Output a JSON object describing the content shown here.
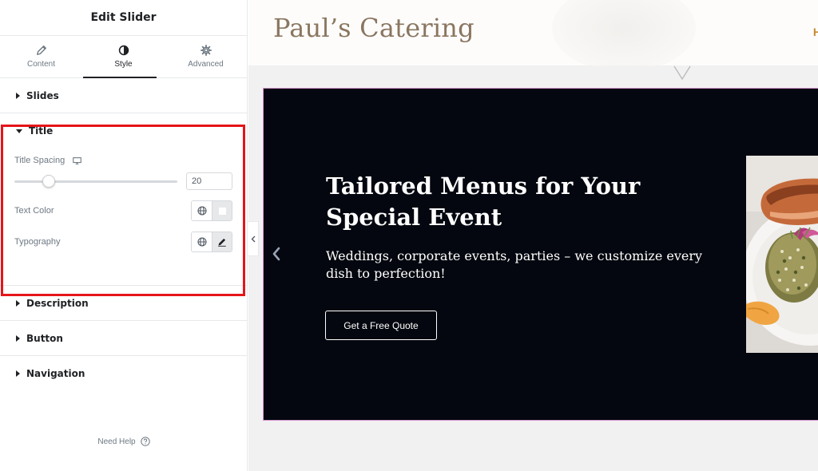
{
  "panel": {
    "title": "Edit Slider",
    "tabs": [
      {
        "label": "Content",
        "icon": "pencil-icon"
      },
      {
        "label": "Style",
        "icon": "half-circle-icon"
      },
      {
        "label": "Advanced",
        "icon": "gear-icon"
      }
    ],
    "active_tab": "Style",
    "sections": {
      "slides": "Slides",
      "title": "Title",
      "description": "Description",
      "button": "Button",
      "navigation": "Navigation"
    },
    "title_controls": {
      "spacing_label": "Title Spacing",
      "spacing_value": "20",
      "spacing_fraction": 0.2,
      "text_color_label": "Text Color",
      "typography_label": "Typography"
    },
    "help": "Need Help",
    "highlight_color": "#e5151a"
  },
  "site": {
    "logo": "Paul’s Catering",
    "nav_peek": "H",
    "slide": {
      "title": "Tailored Menus for Your Special Event",
      "description": "Weddings, corporate events, parties – we customize every dish to perfection!",
      "button": "Get a Free Quote"
    },
    "colors": {
      "logo": "#8a7660",
      "slide_bg": "#04070f",
      "slide_border": "#d597cf",
      "nav_accent": "#c48a2f"
    }
  }
}
